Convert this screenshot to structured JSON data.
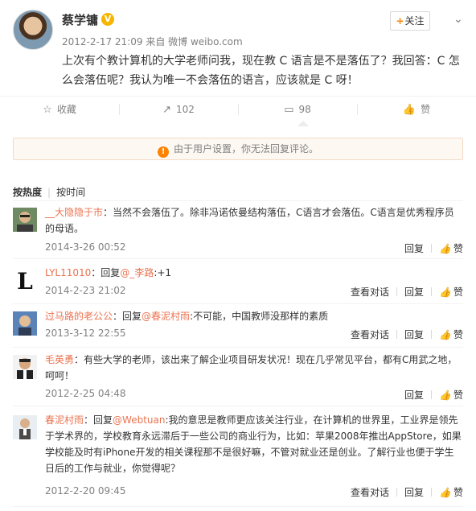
{
  "post": {
    "author": "蔡学镛",
    "verified_mark": "V",
    "meta": "2012-2-17 21:09 来自 微博 weibo.com",
    "follow_label": "关注",
    "more_icon": "chevron-down-icon",
    "text": "上次有个教计算机的大学老师问我，现在教 C 语言是不是落伍了？我回答：C 怎么会落伍呢？我认为唯一不会落伍的语言，应该就是 C 呀！",
    "actions": {
      "favorite": "收藏",
      "repost": "102",
      "comment": "98",
      "like": "赞"
    }
  },
  "notice": {
    "text": "由于用户设置，你无法回复评论。",
    "icon": "warning-icon"
  },
  "sort": {
    "hot": "按热度",
    "time": "按时间"
  },
  "comments": [
    {
      "user": "__大隐隐于市",
      "sep": "：",
      "text": "当然不会落伍了。除非冯诺依曼结构落伍，C语言才会落伍。C语言是优秀程序员的母语。",
      "time": "2014-3-26 00:52",
      "reply": "回复",
      "like": "赞"
    },
    {
      "user": "LYL11010",
      "sep": "：",
      "reply_prefix": "回复",
      "reply_target": "@_李路",
      "text": ":+1",
      "time": "2014-2-23 21:02",
      "view_conversation": "查看对话",
      "reply": "回复",
      "like": "赞"
    },
    {
      "user": "过马路的老公公",
      "sep": "：",
      "reply_prefix": "回复",
      "reply_target": "@春泥村雨",
      "text": ":不可能，中国教师没那样的素质",
      "time": "2013-3-12 22:55",
      "view_conversation": "查看对话",
      "reply": "回复",
      "like": "赞"
    },
    {
      "user": "毛英勇",
      "sep": "：",
      "text": "有些大学的老师，该出来了解企业项目研发状况！现在几乎常见平台，都有C用武之地，呵呵！",
      "time": "2012-2-25 04:48",
      "reply": "回复",
      "like": "赞"
    },
    {
      "user": "春泥村雨",
      "sep": "：",
      "reply_prefix": "回复",
      "reply_target": "@Webtuan",
      "text": ":我的意思是教师更应该关注行业，在计算机的世界里，工业界是领先于学术界的，学校教育永远滞后于一些公司的商业行为，比如：苹果2008年推出AppStore，如果学校能及时有iPhone开发的相关课程那不是很好嘛，不管对就业还是创业。了解行业也便于学生日后的工作与就业，你觉得呢？",
      "time": "2012-2-20 09:45",
      "view_conversation": "查看对话",
      "reply": "回复",
      "like": "赞"
    }
  ]
}
